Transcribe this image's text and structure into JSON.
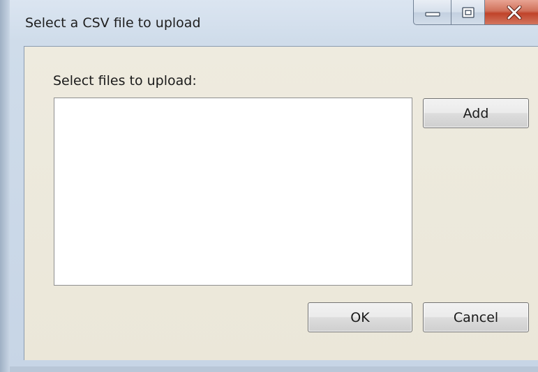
{
  "window": {
    "title": "Select a CSV file to upload",
    "caption_buttons": {
      "minimize_icon": "minimize-icon",
      "maximize_icon": "maximize-icon",
      "close_icon": "close-icon"
    }
  },
  "dialog": {
    "files_label": "Select files to upload:",
    "file_list_items": [],
    "add_label": "Add",
    "ok_label": "OK",
    "cancel_label": "Cancel"
  },
  "colors": {
    "close_button": "#c7442b",
    "dialog_background": "#ece9d8",
    "frame": "#cfdcea"
  }
}
